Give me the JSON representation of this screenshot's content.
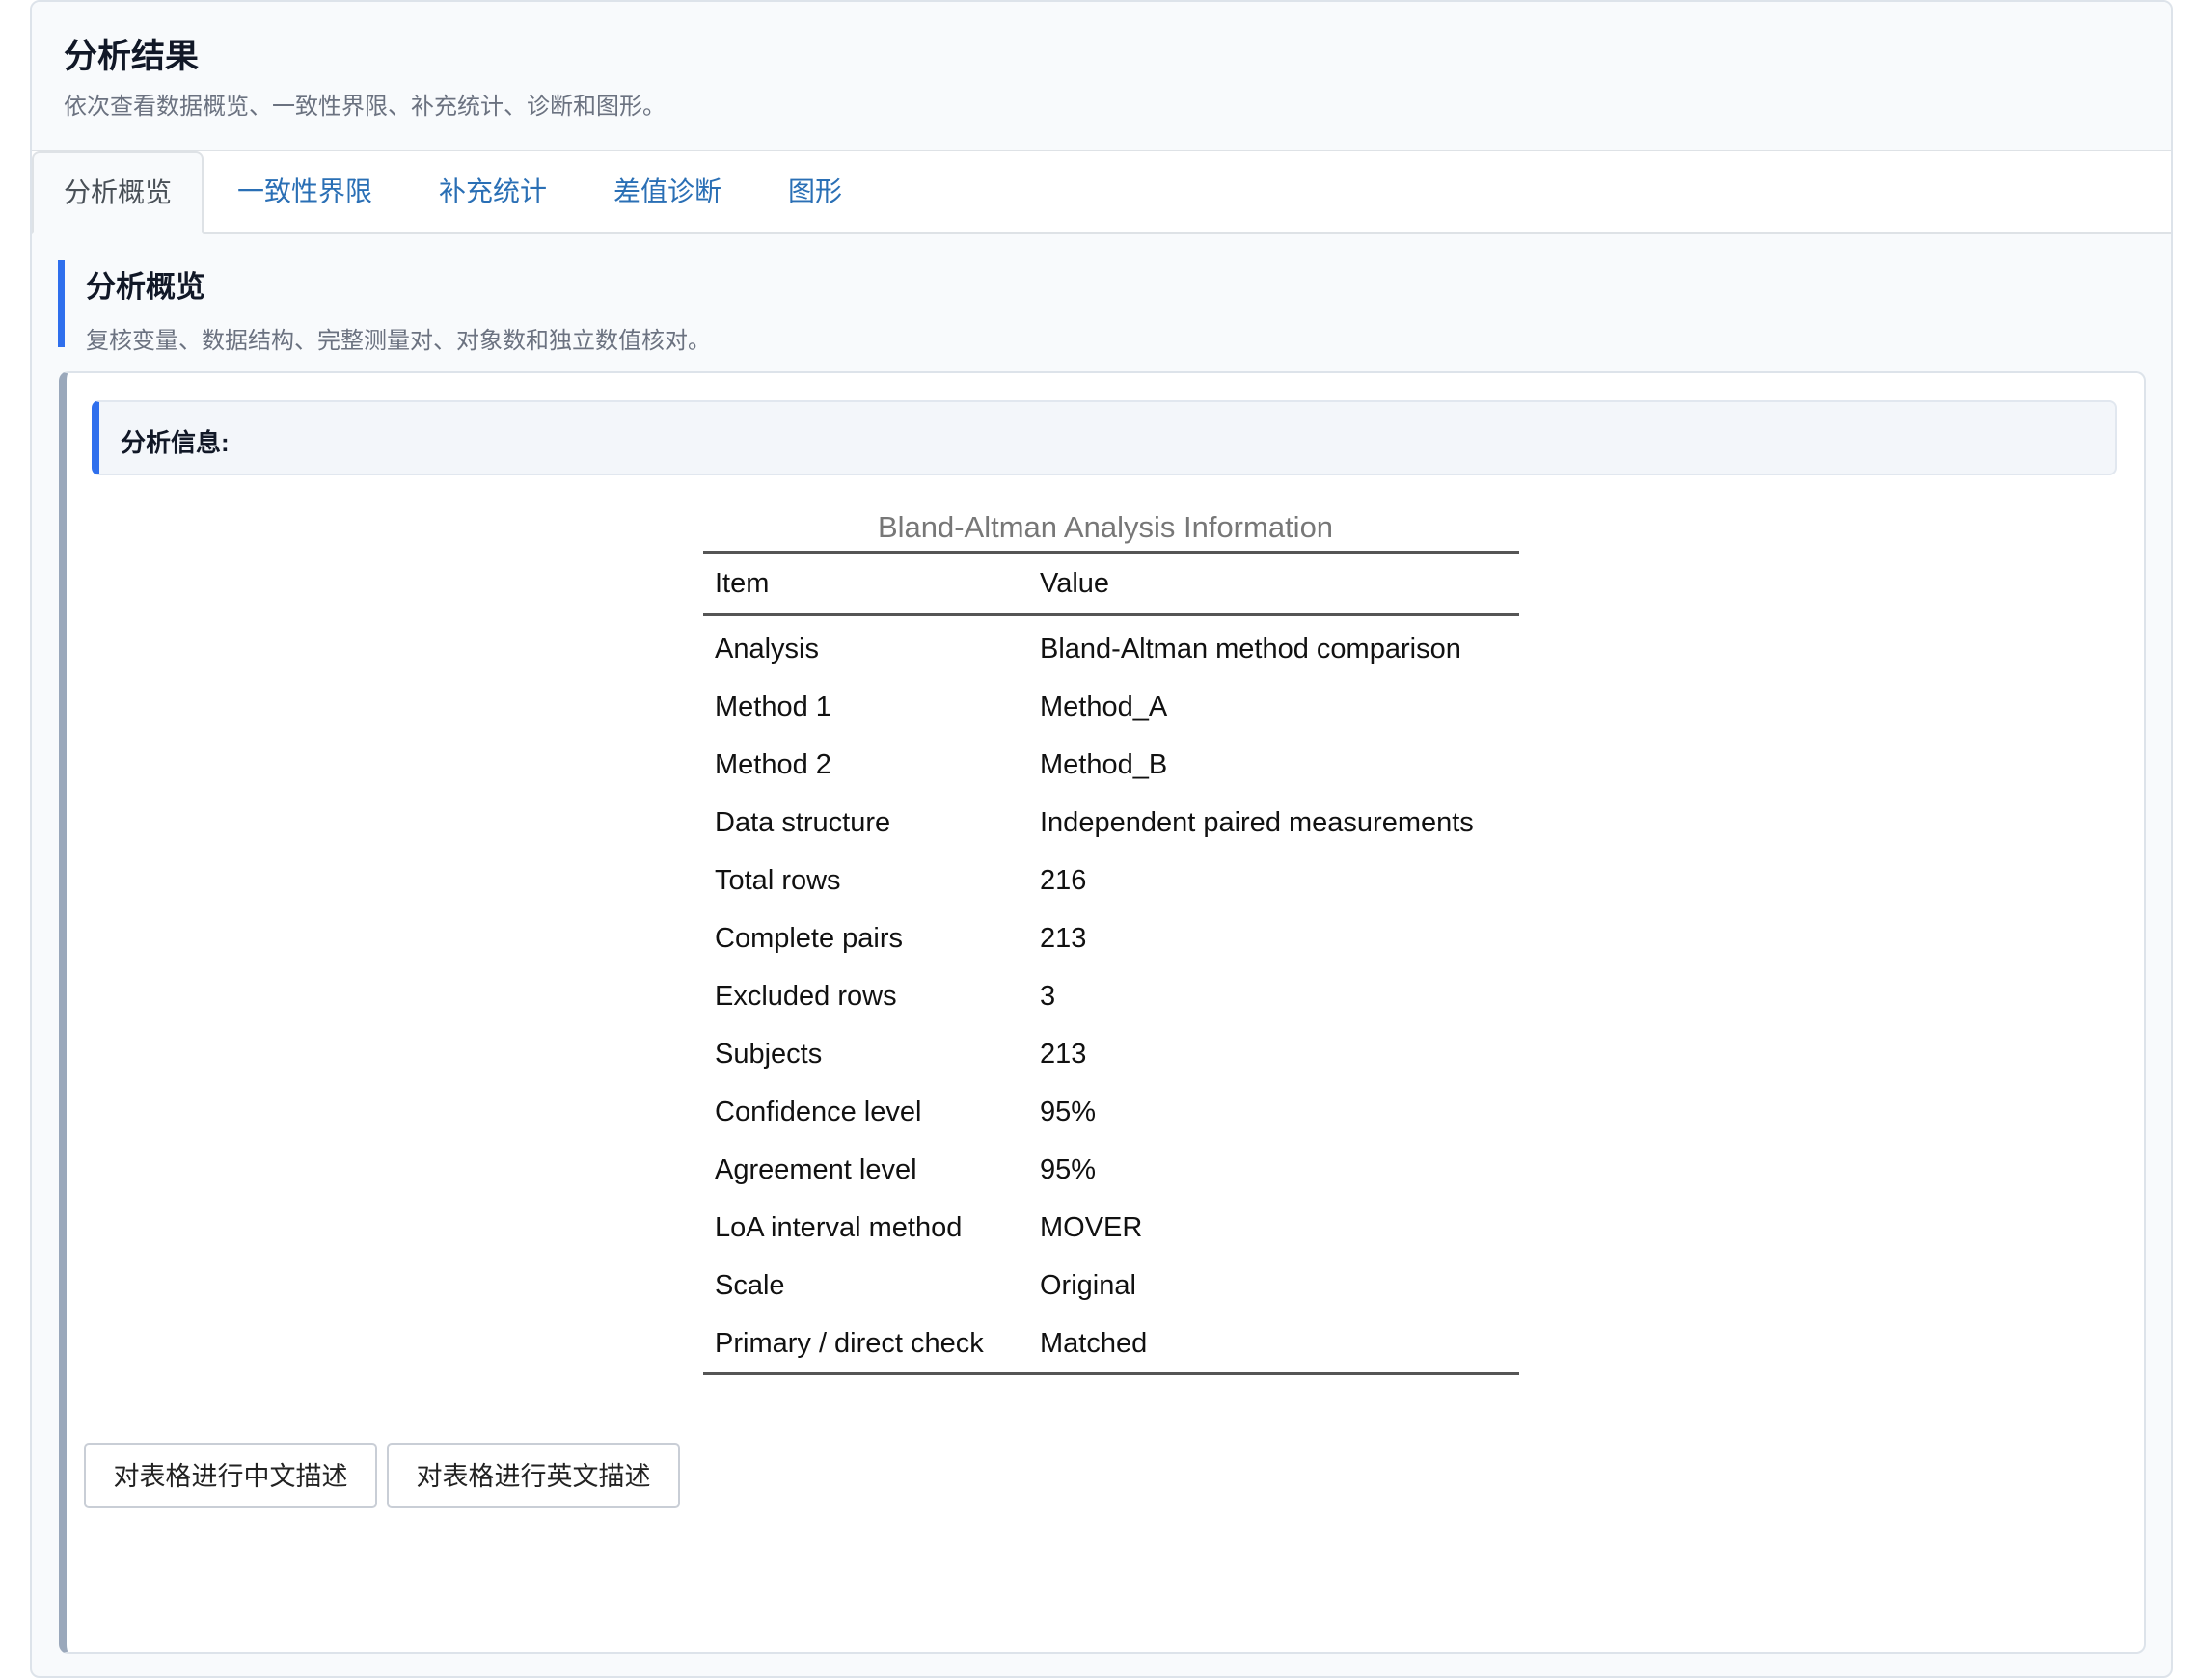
{
  "header": {
    "title": "分析结果",
    "subtitle": "依次查看数据概览、一致性界限、补充统计、诊断和图形。"
  },
  "tabs": [
    {
      "label": "分析概览",
      "active": true
    },
    {
      "label": "一致性界限",
      "active": false
    },
    {
      "label": "补充统计",
      "active": false
    },
    {
      "label": "差值诊断",
      "active": false
    },
    {
      "label": "图形",
      "active": false
    }
  ],
  "section": {
    "title": "分析概览",
    "subtitle": "复核变量、数据结构、完整测量对、对象数和独立数值核对。"
  },
  "info": {
    "label": "分析信息:"
  },
  "table": {
    "caption": "Bland-Altman Analysis Information",
    "columns": [
      "Item",
      "Value"
    ],
    "rows": [
      [
        "Analysis",
        "Bland-Altman method comparison"
      ],
      [
        "Method 1",
        "Method_A"
      ],
      [
        "Method 2",
        "Method_B"
      ],
      [
        "Data structure",
        "Independent paired measurements"
      ],
      [
        "Total rows",
        "216"
      ],
      [
        "Complete pairs",
        "213"
      ],
      [
        "Excluded rows",
        "3"
      ],
      [
        "Subjects",
        "213"
      ],
      [
        "Confidence level",
        "95%"
      ],
      [
        "Agreement level",
        "95%"
      ],
      [
        "LoA interval method",
        "MOVER"
      ],
      [
        "Scale",
        "Original"
      ],
      [
        "Primary / direct check",
        "Matched"
      ]
    ]
  },
  "buttons": {
    "describe_zh": "对表格进行中文描述",
    "describe_en": "对表格进行英文描述"
  },
  "colors": {
    "accent": "#2f6fed",
    "tab_link": "#2a6fb5"
  }
}
